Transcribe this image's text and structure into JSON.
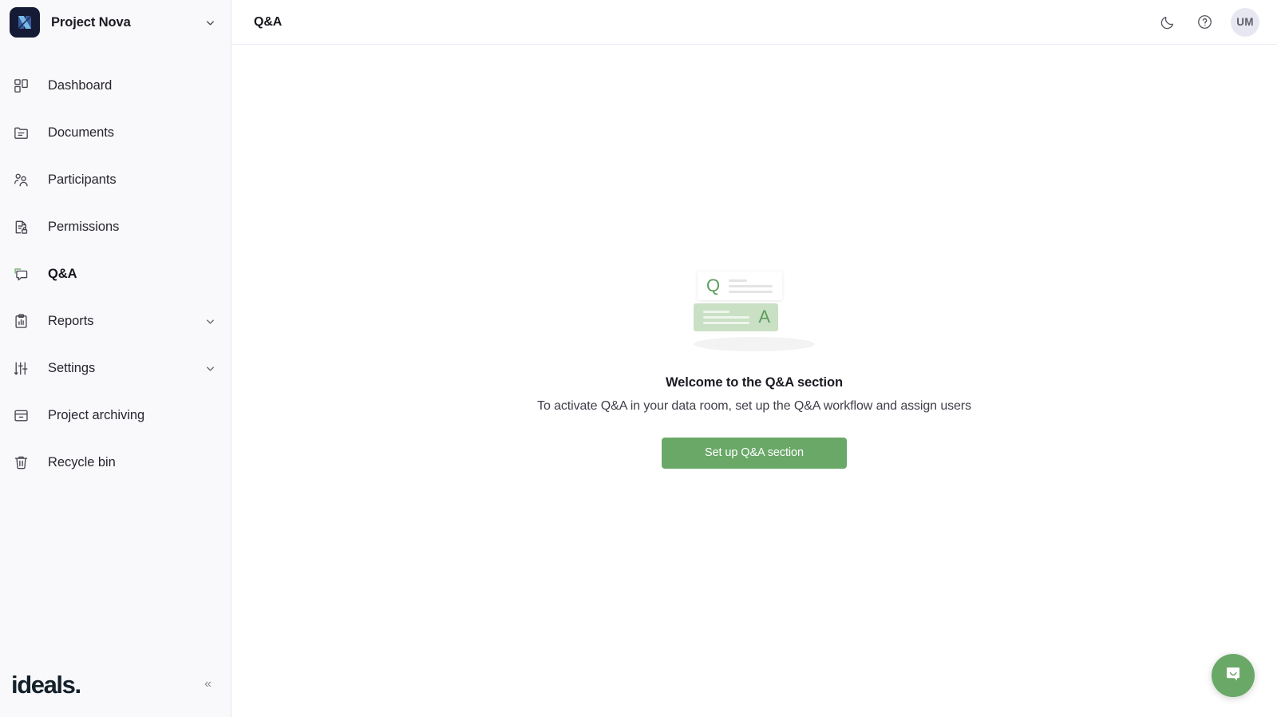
{
  "sidebar": {
    "brand": {
      "name": "Project Nova",
      "logo_icon": "nova-logo-icon",
      "caret_icon": "chevron-down-icon",
      "logo_bg": "#151a35",
      "logo_accent": "#7fc4ef"
    },
    "items": [
      {
        "label": "Dashboard",
        "icon": "layout-dashboard-icon",
        "active": false,
        "expandable": false
      },
      {
        "label": "Documents",
        "icon": "folder-document-icon",
        "active": false,
        "expandable": false
      },
      {
        "label": "Participants",
        "icon": "users-icon",
        "active": false,
        "expandable": false
      },
      {
        "label": "Permissions",
        "icon": "file-lock-icon",
        "active": false,
        "expandable": false
      },
      {
        "label": "Q&A",
        "icon": "chat-bubbles-icon",
        "active": true,
        "expandable": false
      },
      {
        "label": "Reports",
        "icon": "clipboard-chart-icon",
        "active": false,
        "expandable": true
      },
      {
        "label": "Settings",
        "icon": "sliders-icon",
        "active": false,
        "expandable": true
      },
      {
        "label": "Project archiving",
        "icon": "archive-box-icon",
        "active": false,
        "expandable": false
      },
      {
        "label": "Recycle bin",
        "icon": "trash-icon",
        "active": false,
        "expandable": false
      }
    ],
    "footer": {
      "wordmark": "ideals.",
      "collapse_label": "«",
      "collapse_icon": "collapse-sidebar-icon"
    }
  },
  "topbar": {
    "title": "Q&A",
    "dark_mode_icon": "moon-icon",
    "help_icon": "question-circle-icon",
    "avatar_initials": "UM",
    "avatar_bg": "#e7e7f1"
  },
  "empty_state": {
    "illustration": {
      "question_letter": "Q",
      "answer_letter": "A",
      "card_answer_bg": "#c9e0c4",
      "letter_color": "#5c9e5d"
    },
    "heading": "Welcome to the Q&A section",
    "subtext": "To activate Q&A in your data room, set up the Q&A workflow and assign users",
    "cta_label": "Set up Q&A section",
    "cta_color": "#6aa868"
  },
  "chat_launcher": {
    "icon": "chat-smile-icon",
    "color": "#6aa868"
  }
}
